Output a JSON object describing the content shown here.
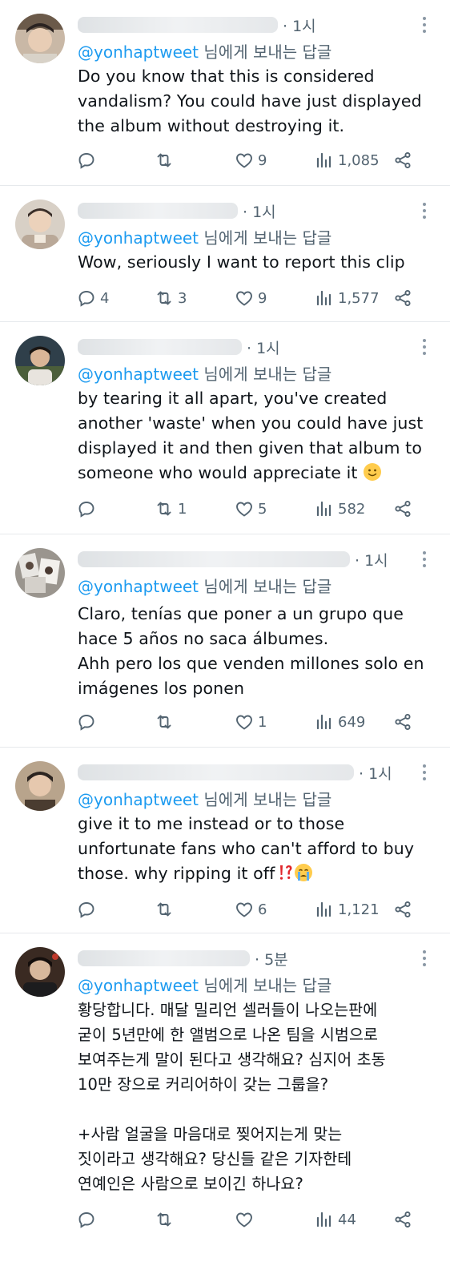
{
  "reply_prefix": "님에게 보내는 답글",
  "tweets": [
    {
      "time": "1시",
      "reply_to": "@yonhaptweet",
      "text": "Do you know that this is considered\nvandalism? You could have just displayed\nthe album without destroying it.",
      "replies": "",
      "retweets": "",
      "likes": "9",
      "views": "1,085"
    },
    {
      "time": "1시",
      "reply_to": "@yonhaptweet",
      "text": "Wow, seriously I want to report this clip",
      "replies": "4",
      "retweets": "3",
      "likes": "9",
      "views": "1,577"
    },
    {
      "time": "1시",
      "reply_to": "@yonhaptweet",
      "text": "by tearing it all apart, you've created\nanother 'waste' when you could have just\ndisplayed it and then given that album to\nsomeone who would appreciate it",
      "emoji_after": "slightly-smiling-face-emoji",
      "replies": "",
      "retweets": "1",
      "likes": "5",
      "views": "582"
    },
    {
      "time": "1시",
      "reply_to": "@yonhaptweet",
      "text": "Claro, tenías que poner a un grupo que\nhace 5 años no saca álbumes.\nAhh pero los que venden millones solo en\nimágenes los ponen",
      "replies": "",
      "retweets": "",
      "likes": "1",
      "views": "649"
    },
    {
      "time": "1시",
      "reply_to": "@yonhaptweet",
      "text": "give it to me instead or to those\nunfortunate fans who can't afford to buy\nthose. why ripping it off",
      "emoji_after": "interrobang-crying-emoji",
      "replies": "",
      "retweets": "",
      "likes": "6",
      "views": "1,121"
    },
    {
      "time": "5분",
      "reply_to": "@yonhaptweet",
      "text": "황당합니다. 매달 밀리언 셀러들이 나오는판에\n굳이 5년만에 한 앨범으로 나온 팀을 시범으로\n보여주는게 말이 된다고 생각해요? 심지어 초동\n10만 장으로 커리어하이 갖는 그룹을?\n\n+사람 얼굴을 마음대로 찢어지는게 맞는\n짓이라고 생각해요? 당신들 같은 기자한테\n연예인은 사람으로 보이긴 하나요?",
      "replies": "",
      "retweets": "",
      "likes": "",
      "views": "44"
    }
  ],
  "colors": {
    "accent": "#1d9bf0",
    "secondary_text": "#536471",
    "primary_text": "#0f1419",
    "divider": "#e6e9ec"
  }
}
